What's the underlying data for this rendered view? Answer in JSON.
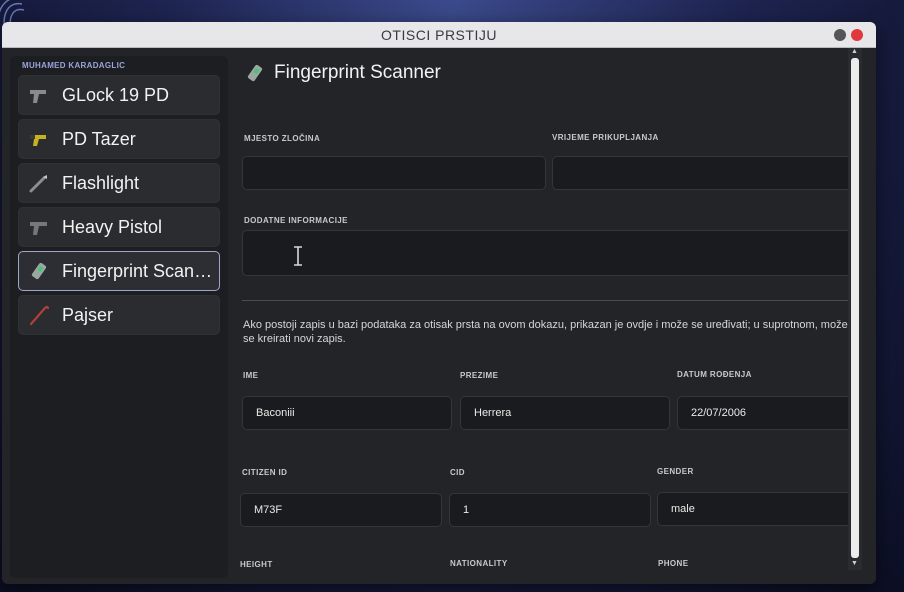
{
  "window": {
    "title": "OTISCI PRSTIJU"
  },
  "sidebar": {
    "user": "MUHAMED KARADAGLIC",
    "items": [
      {
        "label": "GLock 19 PD",
        "icon": "pistol-icon"
      },
      {
        "label": "PD Tazer",
        "icon": "tazer-icon"
      },
      {
        "label": "Flashlight",
        "icon": "flashlight-icon"
      },
      {
        "label": "Heavy Pistol",
        "icon": "pistol-icon"
      },
      {
        "label": "Fingerprint Scanner",
        "icon": "fingerprint-scanner-icon",
        "active": true
      },
      {
        "label": "Pajser",
        "icon": "crowbar-icon"
      }
    ]
  },
  "main": {
    "title": "Fingerprint Scanner",
    "crime_scene": {
      "label": "MJESTO ZLOČINA",
      "value": ""
    },
    "collection_time": {
      "label": "VRIJEME PRIKUPLJANJA",
      "value": ""
    },
    "extra_info": {
      "label": "DODATNE INFORMACIJE",
      "value": ""
    },
    "notice": "Ako postoji zapis u bazi podataka za otisak prsta na ovom dokazu, prikazan je ovdje i može se uređivati; u suprotnom, može se kreirati novi zapis.",
    "first_name": {
      "label": "IME",
      "value": "Baconiii"
    },
    "last_name": {
      "label": "PREZIME",
      "value": "Herrera"
    },
    "dob": {
      "label": "DATUM ROĐENJA",
      "value": "22/07/2006"
    },
    "citizen_id": {
      "label": "CITIZEN ID",
      "value": "M73F"
    },
    "cid": {
      "label": "CID",
      "value": "1"
    },
    "gender": {
      "label": "GENDER",
      "value": "male"
    },
    "height": {
      "label": "HEIGHT",
      "value": ""
    },
    "nationality": {
      "label": "NATIONALITY",
      "value": ""
    },
    "phone": {
      "label": "PHONE",
      "value": ""
    }
  },
  "colors": {
    "accent": "#9ea6c8",
    "close": "#e0383c",
    "panel": "#232428"
  }
}
